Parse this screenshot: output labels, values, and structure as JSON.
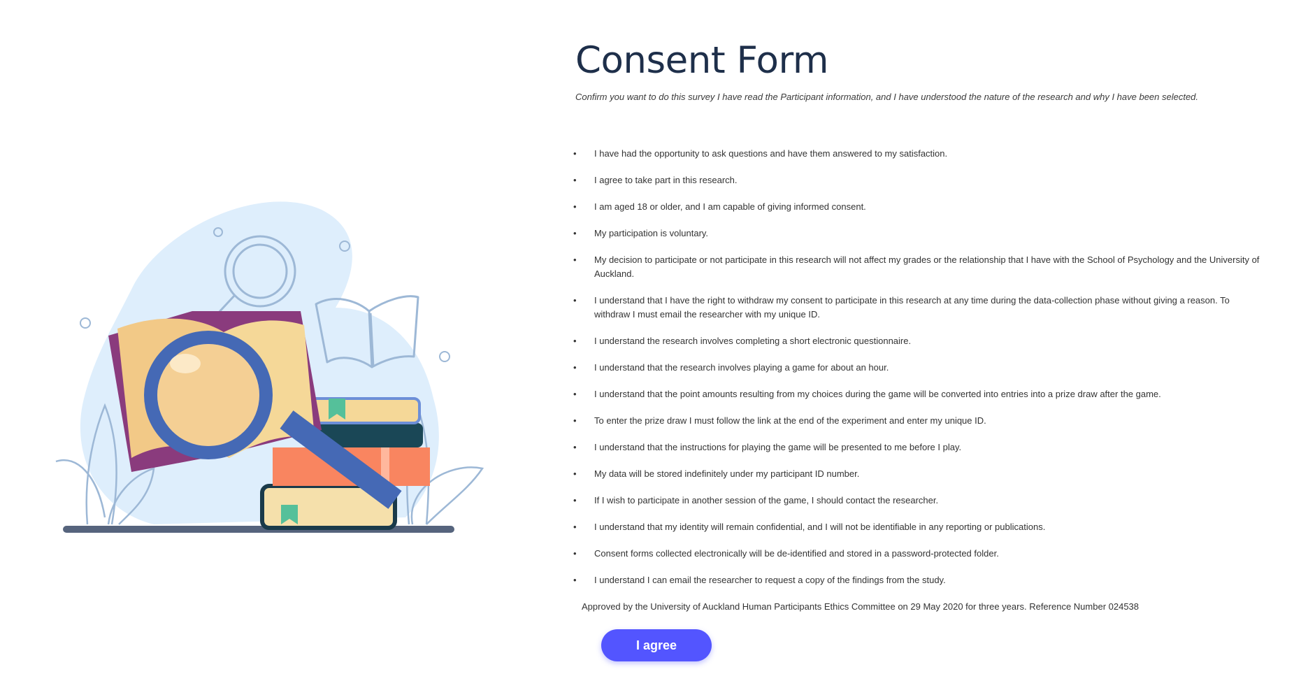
{
  "header": {
    "title": "Consent Form",
    "subtitle": "Confirm you want to do this survey I have read the Participant information, and I have understood the nature of the research and why I have been selected."
  },
  "consent_items": [
    "I have had the opportunity to ask questions and have them answered to my satisfaction.",
    "I agree to take part in this research.",
    "I am aged 18 or older, and I am capable of giving informed consent.",
    "My participation is voluntary.",
    "My decision to participate or not participate in this research will not affect my grades or the relationship that I have with the School of Psychology and the University of Auckland.",
    "I understand that I have the right to withdraw my consent to participate in this research at any time during the data-collection phase without giving a reason. To withdraw I must email the researcher with my unique ID.",
    "I understand the research involves completing a short electronic questionnaire.",
    "I understand that the research involves playing a game for about an hour.",
    "I understand that the point amounts resulting from my choices during the game will be converted into entries into a prize draw after the game.",
    "To enter the prize draw I must follow the link at the end of the experiment and enter my unique ID.",
    "I understand that the instructions for playing the game will be presented to me before I play.",
    "My data will be stored indefinitely under my participant ID number.",
    "If I wish to participate in another session of the game, I should contact the researcher.",
    "I understand that my identity will remain confidential, and I will not be identifiable in any reporting or publications.",
    "Consent forms collected electronically will be de-identified and stored in a password-protected folder.",
    "I understand I can email the researcher to request a copy of the findings from the study."
  ],
  "bullet_glyph": "•",
  "approval": "Approved by the University of Auckland Human Participants Ethics Committee on 29 May 2020 for three years. Reference Number 024538",
  "actions": {
    "agree_label": "I agree"
  },
  "colors": {
    "title": "#1e2f4a",
    "button": "#5355ff",
    "blob": "#deeefc",
    "magnifier": "#4569b5"
  },
  "illustration": {
    "icons": [
      "magnifying-glass-icon",
      "open-book-icon",
      "book-stack-icon",
      "plant-icon"
    ]
  }
}
